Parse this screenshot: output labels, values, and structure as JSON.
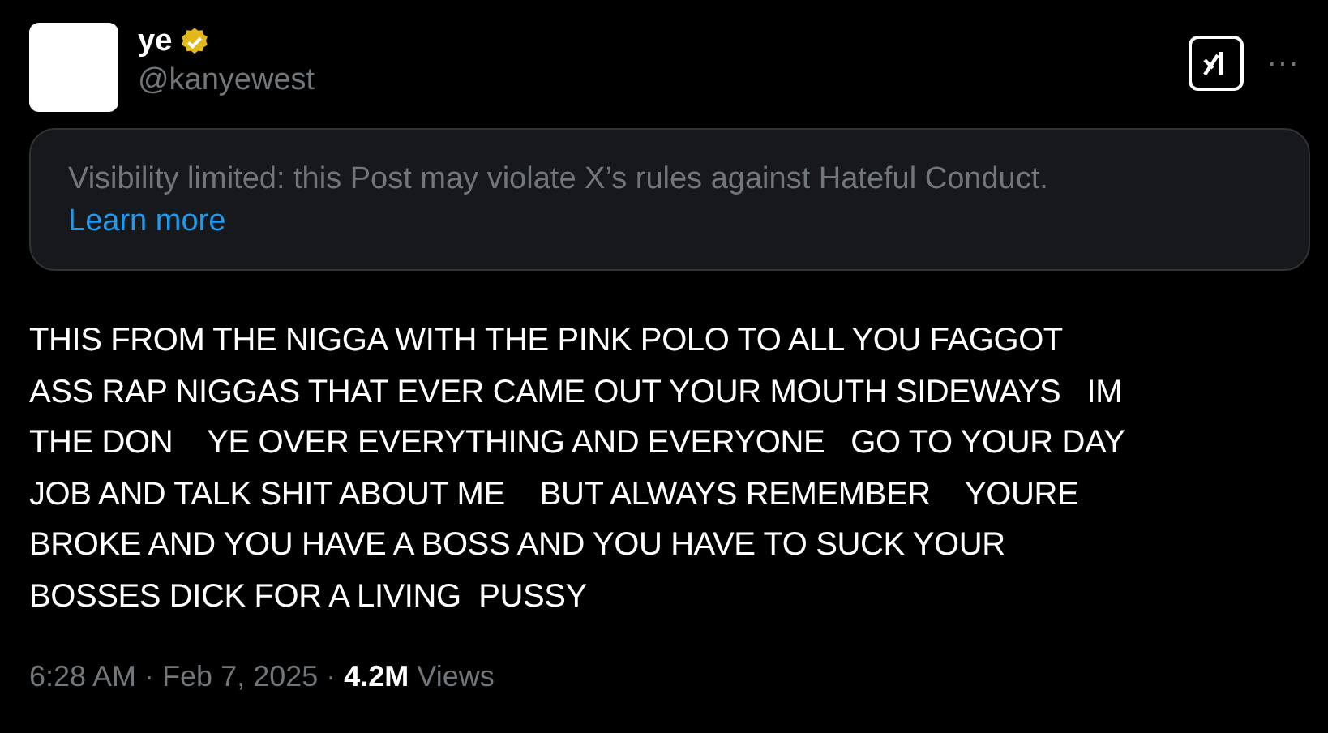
{
  "author": {
    "name": "ye",
    "verified": true,
    "handle": "@kanyewest"
  },
  "header_actions": {
    "more": "···"
  },
  "notice": {
    "text": "Visibility limited: this Post may violate X’s rules against Hateful Conduct.",
    "link": "Learn more"
  },
  "post_text": "THIS FROM THE NIGGA WITH THE PINK POLO TO ALL YOU FAGGOT\nASS RAP NIGGAS THAT EVER CAME OUT YOUR MOUTH SIDEWAYS   IM\nTHE DON    YE OVER EVERYTHING AND EVERYONE   GO TO YOUR DAY\nJOB AND TALK SHIT ABOUT ME    BUT ALWAYS REMEMBER    YOURE\nBROKE AND YOU HAVE A BOSS AND YOU HAVE TO SUCK YOUR\nBOSSES DICK FOR A LIVING  PUSSY",
  "footer": {
    "time": "6:28 AM",
    "separator_1": "·",
    "date": "Feb 7, 2025",
    "separator_2": "·",
    "views_count": "4.2M",
    "views_label": "Views"
  }
}
